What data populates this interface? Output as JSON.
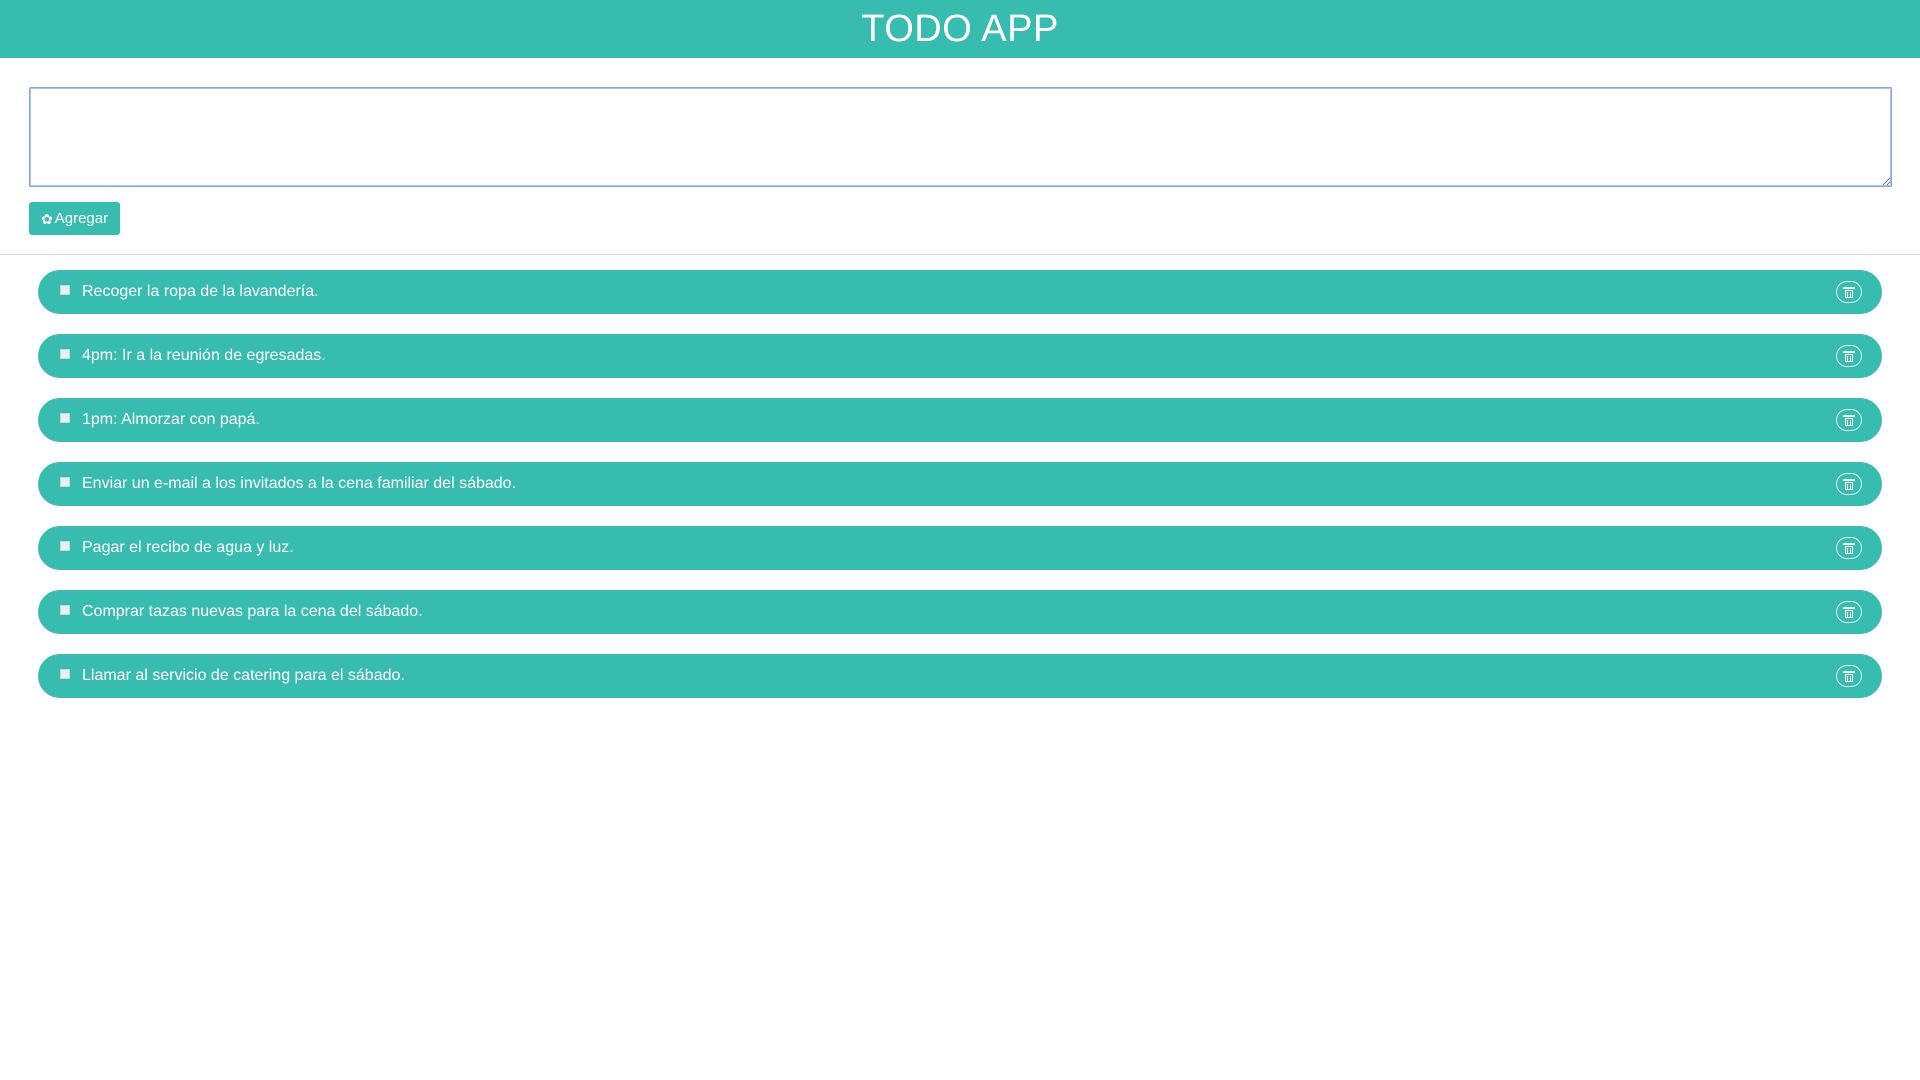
{
  "app": {
    "title": "TODO APP"
  },
  "form": {
    "input_value": "",
    "input_placeholder": "",
    "add_label": "Agregar",
    "add_icon": "gear-icon"
  },
  "todos": [
    {
      "text": "Recoger la ropa de la lavandería.",
      "done": false
    },
    {
      "text": "4pm: Ir a la reunión de egresadas.",
      "done": false
    },
    {
      "text": "1pm: Almorzar con papá.",
      "done": false
    },
    {
      "text": "Enviar un e-mail a los invitados a la cena familiar del sábado.",
      "done": false
    },
    {
      "text": "Pagar el recibo de agua y luz.",
      "done": false
    },
    {
      "text": "Comprar tazas nuevas para la cena del sábado.",
      "done": false
    },
    {
      "text": "Llamar al servicio de catering para el sábado.",
      "done": false
    }
  ],
  "colors": {
    "accent": "#38bcb0",
    "text_on_accent": "#ffffff"
  }
}
